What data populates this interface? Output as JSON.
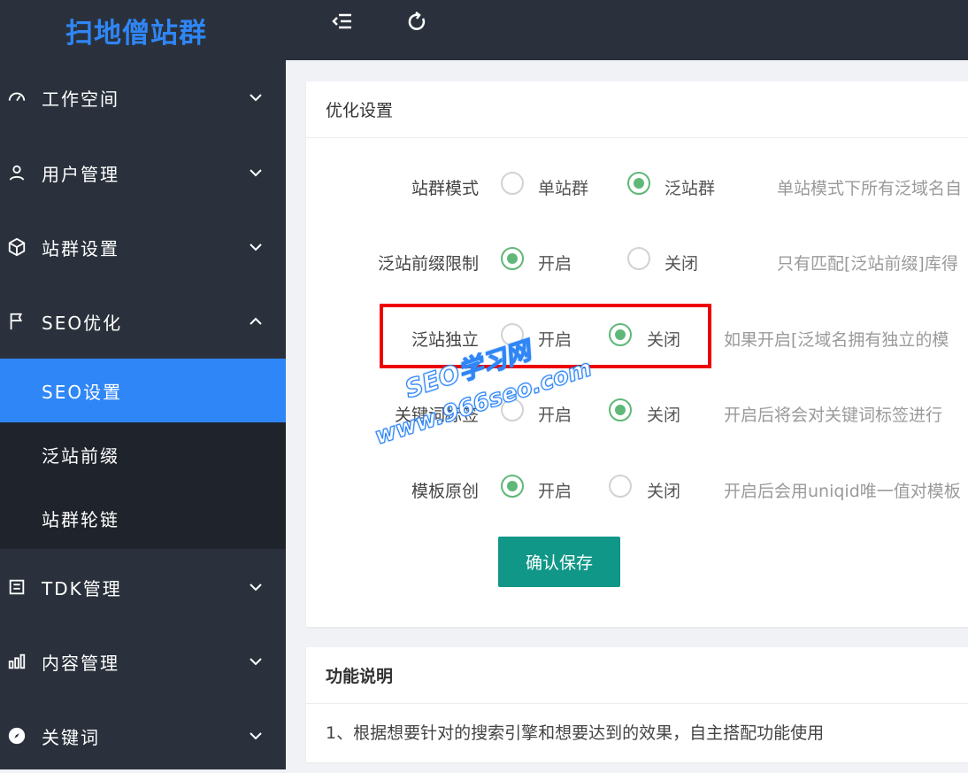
{
  "logo": "扫地僧站群",
  "sidebar": {
    "items": [
      {
        "label": "工作空间",
        "icon": "dashboard-icon"
      },
      {
        "label": "用户管理",
        "icon": "user-icon"
      },
      {
        "label": "站群设置",
        "icon": "cube-icon"
      },
      {
        "label": "SEO优化",
        "icon": "flag-icon"
      },
      {
        "label": "TDK管理",
        "icon": "document-icon"
      },
      {
        "label": "内容管理",
        "icon": "chart-icon"
      },
      {
        "label": "关键词",
        "icon": "compass-icon"
      }
    ],
    "submenu": [
      {
        "label": "SEO设置",
        "active": true
      },
      {
        "label": "泛站前缀",
        "active": false
      },
      {
        "label": "站群轮链",
        "active": false
      }
    ]
  },
  "topbar": {
    "icons": [
      "menu-collapse-icon",
      "refresh-icon"
    ]
  },
  "settings": {
    "title": "优化设置",
    "rows": [
      {
        "label": "站群模式",
        "options": [
          "单站群",
          "泛站群"
        ],
        "selected": 1,
        "desc": "单站模式下所有泛域名自"
      },
      {
        "label": "泛站前缀限制",
        "options": [
          "开启",
          "关闭"
        ],
        "selected": 0,
        "desc": "只有匹配[泛站前缀]库得"
      },
      {
        "label": "泛站独立",
        "options": [
          "开启",
          "关闭"
        ],
        "selected": 1,
        "desc": "如果开启[泛域名拥有独立的模"
      },
      {
        "label": "关键词标签",
        "options": [
          "开启",
          "关闭"
        ],
        "selected": 1,
        "desc": "开启后将会对关键词标签进行"
      },
      {
        "label": "模板原创",
        "options": [
          "开启",
          "关闭"
        ],
        "selected": 0,
        "desc": "开启后会用uniqid唯一值对模板"
      }
    ],
    "save_label": "确认保存"
  },
  "watermark": {
    "line1": "SEO学习网",
    "line2": "www.966seo.com"
  },
  "info": {
    "title": "功能说明",
    "text": "1、根据想要针对的搜索引擎和想要达到的效果，自主搭配功能使用"
  },
  "colors": {
    "accent": "#2f86f6",
    "sidebar": "#2a313c",
    "radio_on": "#5fb878",
    "button": "#119788",
    "highlight": "#e00000"
  }
}
